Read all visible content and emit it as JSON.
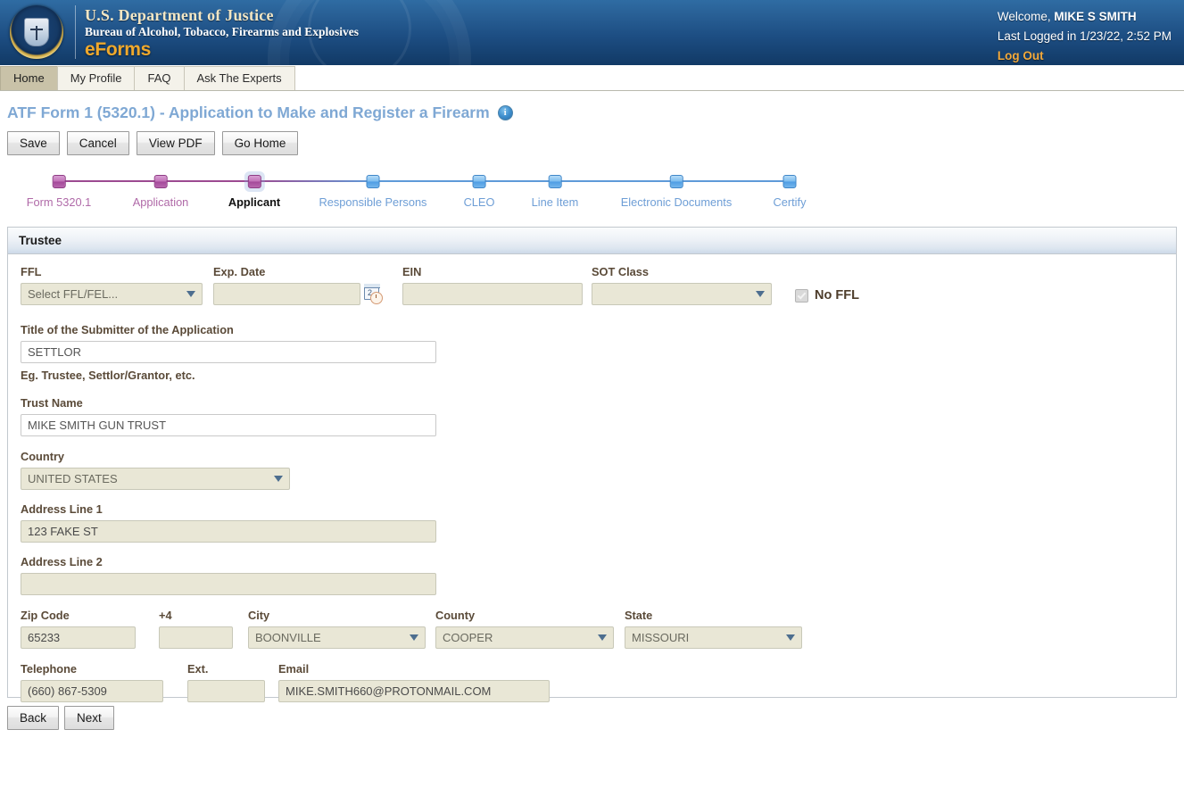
{
  "header": {
    "seal_alt": "doj-seal",
    "agency_line1": "U.S. Department of Justice",
    "agency_line2": "Bureau of Alcohol, Tobacco, Firearms and Explosives",
    "product": "eForms",
    "welcome_prefix": "Welcome,",
    "user_name": "MIKE S SMITH",
    "last_logged": "Last Logged in 1/23/22, 2:52 PM",
    "logout": "Log Out"
  },
  "nav_tabs": [
    {
      "label": "Home",
      "active": true
    },
    {
      "label": "My Profile",
      "active": false
    },
    {
      "label": "FAQ",
      "active": false
    },
    {
      "label": "Ask The Experts",
      "active": false
    }
  ],
  "page": {
    "title": "ATF Form 1 (5320.1) - Application to Make and Register a Firearm",
    "info_icon_glyph": "i"
  },
  "toolbar": {
    "save_label": "Save",
    "cancel_label": "Cancel",
    "viewpdf_label": "View PDF",
    "gohome_label": "Go Home"
  },
  "wizard": {
    "steps": [
      {
        "label": "Form 5320.1",
        "state": "done"
      },
      {
        "label": "Application",
        "state": "done"
      },
      {
        "label": "Applicant",
        "state": "current"
      },
      {
        "label": "Responsible Persons",
        "state": "todo"
      },
      {
        "label": "CLEO",
        "state": "todo"
      },
      {
        "label": "Line Item",
        "state": "todo"
      },
      {
        "label": "Electronic Documents",
        "state": "todo"
      },
      {
        "label": "Certify",
        "state": "todo"
      }
    ],
    "done_color": "#a4489a",
    "todo_color": "#4e9de4"
  },
  "panel": {
    "title": "Trustee"
  },
  "form": {
    "ffl": {
      "label": "FFL",
      "value": "Select FFL/FEL...",
      "type": "select"
    },
    "exp_date": {
      "label": "Exp. Date",
      "value": "",
      "placeholder": "",
      "icon": "calendar-clock-icon"
    },
    "ein": {
      "label": "EIN",
      "value": "",
      "placeholder": ""
    },
    "sot_class": {
      "label": "SOT Class",
      "value": "",
      "type": "select"
    },
    "no_ffl": {
      "label": "No FFL",
      "checked": true,
      "disabled": true
    },
    "submitter_title": {
      "label": "Title of the Submitter of the Application",
      "value": "SETTLOR",
      "helper": "Eg. Trustee, Settlor/Grantor, etc."
    },
    "trust_name": {
      "label": "Trust Name",
      "value": "MIKE SMITH GUN TRUST"
    },
    "country": {
      "label": "Country",
      "value": "UNITED STATES",
      "type": "select"
    },
    "address1": {
      "label": "Address Line 1",
      "value": "123 FAKE ST"
    },
    "address2": {
      "label": "Address Line 2",
      "value": ""
    },
    "zip": {
      "label": "Zip Code",
      "value": "65233"
    },
    "zip4": {
      "label": "+4",
      "value": ""
    },
    "city": {
      "label": "City",
      "value": "BOONVILLE",
      "type": "select"
    },
    "county": {
      "label": "County",
      "value": "COOPER",
      "type": "select"
    },
    "state": {
      "label": "State",
      "value": "MISSOURI",
      "type": "select"
    },
    "telephone": {
      "label": "Telephone",
      "value": "(660) 867-5309"
    },
    "ext": {
      "label": "Ext.",
      "value": ""
    },
    "email": {
      "label": "Email",
      "value": "MIKE.SMITH660@PROTONMAIL.COM"
    }
  },
  "footer": {
    "back_label": "Back",
    "next_label": "Next"
  }
}
